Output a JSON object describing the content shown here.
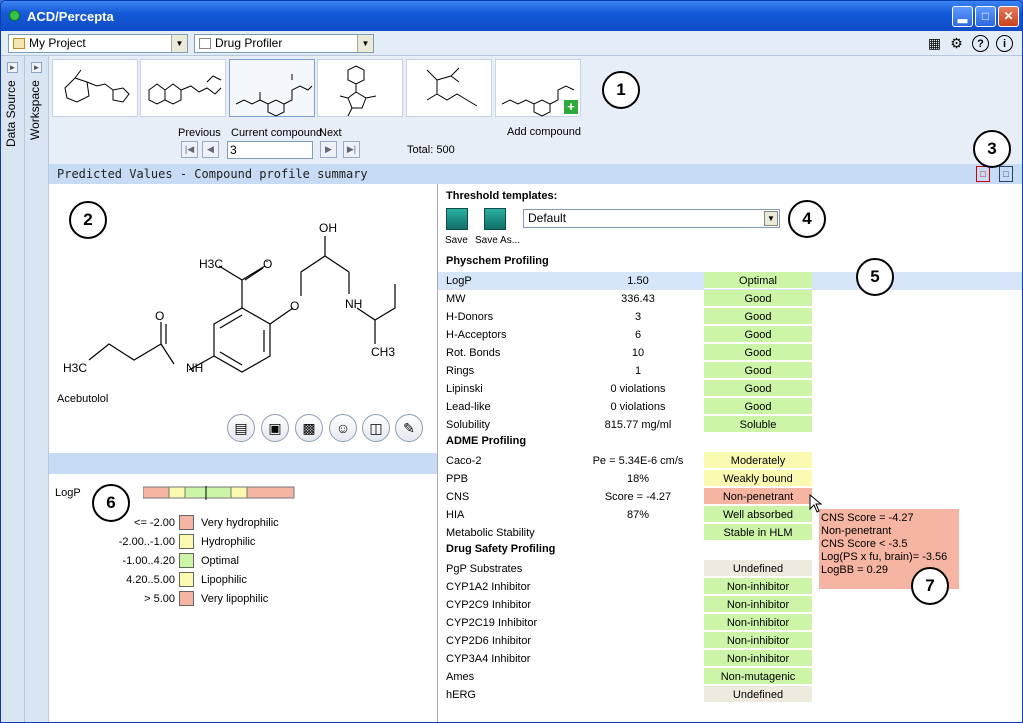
{
  "window": {
    "title": "ACD/Percepta"
  },
  "toolbar": {
    "project": "My Project",
    "module": "Drug Profiler"
  },
  "sidebar_tabs": [
    "Data Source",
    "Workspace"
  ],
  "navigation": {
    "previous_label": "Previous",
    "current_label": "Current compound",
    "next_label": "Next",
    "current_value": "3",
    "total": "Total: 500",
    "add_label": "Add compound"
  },
  "section_title": "Predicted Values - Compound profile summary",
  "structure": {
    "compound_name": "Acebutolol",
    "atoms": {
      "h3c1": "H3C",
      "o1": "O",
      "oh": "OH",
      "o2": "O",
      "nh1": "NH",
      "o3": "O",
      "h3c2": "H3C",
      "nh2": "NH",
      "ch3": "CH3"
    }
  },
  "legend": {
    "property": "LogP",
    "rows": [
      {
        "range": "<= -2.00",
        "label": "Very hydrophilic",
        "color": "#f5b5a2"
      },
      {
        "range": "-2.00..-1.00",
        "label": "Hydrophilic",
        "color": "#fafbb0"
      },
      {
        "range": "-1.00..4.20",
        "label": "Optimal",
        "color": "#ccf5a8"
      },
      {
        "range": "4.20..5.00",
        "label": "Lipophilic",
        "color": "#fafbb0"
      },
      {
        "range": "> 5.00",
        "label": "Very lipophilic",
        "color": "#f5b5a2"
      }
    ]
  },
  "templates": {
    "heading": "Threshold templates:",
    "save": "Save",
    "save_as": "Save As...",
    "selected": "Default"
  },
  "physchem": {
    "title": "Physchem Profiling",
    "rows": [
      {
        "name": "LogP",
        "value": "1.50",
        "status": "Optimal",
        "c": "g"
      },
      {
        "name": "MW",
        "value": "336.43",
        "status": "Good",
        "c": "g"
      },
      {
        "name": "H-Donors",
        "value": "3",
        "status": "Good",
        "c": "g"
      },
      {
        "name": "H-Acceptors",
        "value": "6",
        "status": "Good",
        "c": "g"
      },
      {
        "name": "Rot. Bonds",
        "value": "10",
        "status": "Good",
        "c": "g"
      },
      {
        "name": "Rings",
        "value": "1",
        "status": "Good",
        "c": "g"
      },
      {
        "name": "Lipinski",
        "value": "0 violations",
        "status": "Good",
        "c": "g"
      },
      {
        "name": "Lead-like",
        "value": "0 violations",
        "status": "Good",
        "c": "g"
      },
      {
        "name": "Solubility",
        "value": "815.77 mg/ml",
        "status": "Soluble",
        "c": "g"
      }
    ]
  },
  "adme": {
    "title": "ADME Profiling",
    "rows": [
      {
        "name": "Caco-2",
        "value": "Pe = 5.34E-6 cm/s",
        "status": "Moderately permeable",
        "c": "y"
      },
      {
        "name": "PPB",
        "value": "18%",
        "status": "Weakly bound",
        "c": "y"
      },
      {
        "name": "CNS",
        "value": "Score = -4.27",
        "status": "Non-penetrant",
        "c": "r"
      },
      {
        "name": "HIA",
        "value": "87%",
        "status": "Well absorbed",
        "c": "g"
      },
      {
        "name": "Metabolic Stability",
        "value": "",
        "status": "Stable in HLM",
        "c": "g"
      }
    ]
  },
  "safety": {
    "title": "Drug Safety Profiling",
    "rows": [
      {
        "name": "PgP Substrates",
        "value": "",
        "status": "Undefined",
        "c": "u"
      },
      {
        "name": "CYP1A2 Inhibitor",
        "value": "",
        "status": "Non-inhibitor",
        "c": "g"
      },
      {
        "name": "CYP2C9 Inhibitor",
        "value": "",
        "status": "Non-inhibitor",
        "c": "g"
      },
      {
        "name": "CYP2C19 Inhibitor",
        "value": "",
        "status": "Non-inhibitor",
        "c": "g"
      },
      {
        "name": "CYP2D6 Inhibitor",
        "value": "",
        "status": "Non-inhibitor",
        "c": "g"
      },
      {
        "name": "CYP3A4 Inhibitor",
        "value": "",
        "status": "Non-inhibitor",
        "c": "g"
      },
      {
        "name": "Ames",
        "value": "",
        "status": "Non-mutagenic",
        "c": "g"
      },
      {
        "name": "hERG",
        "value": "",
        "status": "Undefined",
        "c": "u"
      }
    ]
  },
  "tooltip": {
    "lines": [
      "CNS Score = -4.27",
      "Non-penetrant",
      "CNS Score < -3.5",
      "Log(PS x fu, brain)= -3.56",
      "LogBB = 0.29"
    ]
  },
  "callouts": [
    "1",
    "2",
    "3",
    "4",
    "5",
    "6",
    "7"
  ]
}
